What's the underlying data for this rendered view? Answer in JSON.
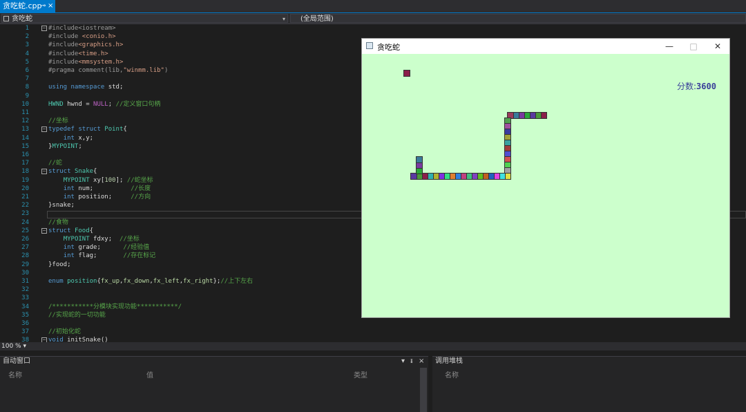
{
  "tab": {
    "title": "贪吃蛇.cpp",
    "pin_icon": "pin-icon",
    "close_label": "×"
  },
  "navbar": {
    "file_scope": "贪吃蛇",
    "global_scope": "(全局范围)"
  },
  "editor": {
    "lines": [
      {
        "n": "1",
        "html": "<span class=\"pp\">#include&lt;iostream&gt;</span>"
      },
      {
        "n": "2",
        "html": "<span class=\"pp\">#include </span><span class=\"str\">&lt;conio.h&gt;</span>"
      },
      {
        "n": "3",
        "html": "<span class=\"pp\">#include</span><span class=\"str\">&lt;graphics.h&gt;</span>"
      },
      {
        "n": "4",
        "html": "<span class=\"pp\">#include</span><span class=\"str\">&lt;time.h&gt;</span>"
      },
      {
        "n": "5",
        "html": "<span class=\"pp\">#include</span><span class=\"str\">&lt;mmsystem.h&gt;</span>"
      },
      {
        "n": "6",
        "html": "<span class=\"pp\">#pragma comment(lib,</span><span class=\"str\">\"winmm.lib\"</span><span class=\"pp\">)</span>"
      },
      {
        "n": "7",
        "html": ""
      },
      {
        "n": "8",
        "html": "<span class=\"kw\">using namespace</span> std;"
      },
      {
        "n": "9",
        "html": ""
      },
      {
        "n": "10",
        "html": "<span class=\"ty\">HWND</span> hwnd = <span class=\"mac\">NULL</span>; <span class=\"cm\">//定义窗口句柄</span>"
      },
      {
        "n": "11",
        "html": ""
      },
      {
        "n": "12",
        "html": "<span class=\"cm\">//坐标</span>"
      },
      {
        "n": "13",
        "html": "<span class=\"kw\">typedef struct</span> <span class=\"ty\">Point</span>{"
      },
      {
        "n": "14",
        "html": "    <span class=\"kw\">int</span> x,y;"
      },
      {
        "n": "15",
        "html": "}<span class=\"ty\">MYPOINT</span>;"
      },
      {
        "n": "16",
        "html": ""
      },
      {
        "n": "17",
        "html": "<span class=\"cm\">//蛇</span>"
      },
      {
        "n": "18",
        "html": "<span class=\"kw\">struct</span> <span class=\"ty\">Snake</span>{"
      },
      {
        "n": "19",
        "html": "    <span class=\"ty\">MYPOINT</span> xy[<span class=\"num\">100</span>]; <span class=\"cm\">//蛇坐标</span>"
      },
      {
        "n": "20",
        "html": "    <span class=\"kw\">int</span> num;          <span class=\"cm\">//长度</span>"
      },
      {
        "n": "21",
        "html": "    <span class=\"kw\">int</span> position;     <span class=\"cm\">//方向</span>"
      },
      {
        "n": "22",
        "html": "}snake;"
      },
      {
        "n": "23",
        "html": ""
      },
      {
        "n": "24",
        "html": "<span class=\"cm\">//食物</span>"
      },
      {
        "n": "25",
        "html": "<span class=\"kw\">struct</span> <span class=\"ty\">Food</span>{"
      },
      {
        "n": "26",
        "html": "    <span class=\"ty\">MYPOINT</span> fdxy;  <span class=\"cm\">//坐标</span>"
      },
      {
        "n": "27",
        "html": "    <span class=\"kw\">int</span> grade;      <span class=\"cm\">//经验值</span>"
      },
      {
        "n": "28",
        "html": "    <span class=\"kw\">int</span> flag;       <span class=\"cm\">//存在标记</span>"
      },
      {
        "n": "29",
        "html": "}food;"
      },
      {
        "n": "30",
        "html": ""
      },
      {
        "n": "31",
        "html": "<span class=\"kw\">enum</span> <span class=\"ty\">position</span>{<span class=\"en\">fx_up</span>,<span class=\"en\">fx_down</span>,<span class=\"en\">fx_left</span>,<span class=\"en\">fx_right</span>};<span class=\"cm\">//上下左右</span>"
      },
      {
        "n": "32",
        "html": ""
      },
      {
        "n": "33",
        "html": ""
      },
      {
        "n": "34",
        "html": "<span class=\"cm\">/***********分模块实现功能***********/</span>"
      },
      {
        "n": "35",
        "html": "<span class=\"cm\">//实现蛇的一切功能</span>"
      },
      {
        "n": "36",
        "html": ""
      },
      {
        "n": "37",
        "html": "<span class=\"cm\">//初始化蛇</span>"
      },
      {
        "n": "38",
        "html": "<span class=\"kw\">void</span> initSnake()"
      }
    ]
  },
  "zoom": {
    "level": "100 %"
  },
  "panels": {
    "auto_window": {
      "title": "自动窗口",
      "cols": [
        "名称",
        "值",
        "类型"
      ],
      "ctl_dropdown": "▾",
      "ctl_pin": "ᵻ",
      "ctl_close": "×"
    },
    "call_stack": {
      "title": "调用堆栈",
      "cols": [
        "名称"
      ]
    }
  },
  "game": {
    "title": "贪吃蛇",
    "minimize": "—",
    "maximize": "□",
    "close": "✕",
    "score_label": "分数:",
    "score_value": "3600",
    "food_color": "#8b1e4a",
    "snake_colors": [
      "#8b1e4a",
      "#4a9a3a",
      "#5a3aa0",
      "#2aa83a",
      "#7a3aa0",
      "#3a7a9a",
      "#9a3a5a",
      "#50a050",
      "#a050a0",
      "#3a3aa0",
      "#a0a03a",
      "#3aa0a0",
      "#a03a3a",
      "#5050d0",
      "#d05050",
      "#50d050",
      "#a0a0a0",
      "#e0e040",
      "#40e0e0",
      "#e040e0",
      "#2060c0",
      "#c06020",
      "#60c020",
      "#8040c0",
      "#40c080",
      "#c04080",
      "#3080e0",
      "#e08030",
      "#30e080",
      "#8030e0",
      "#b0b030",
      "#30b0b0"
    ]
  }
}
